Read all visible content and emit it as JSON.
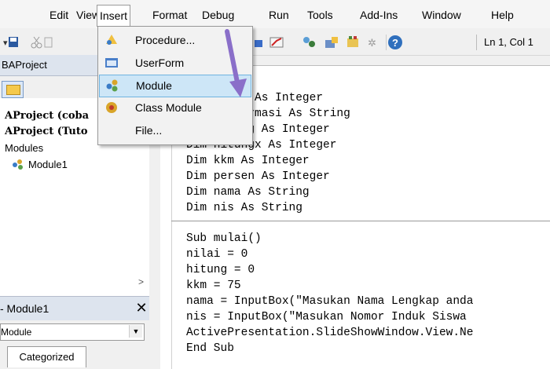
{
  "menubar": {
    "items": [
      "Edit",
      "View",
      "Insert",
      "Format",
      "Debug",
      "Run",
      "Tools",
      "Add-Ins",
      "Window",
      "Help"
    ]
  },
  "toolbar": {
    "position": "Ln 1, Col 1"
  },
  "project": {
    "title": "BAProject",
    "tree": [
      "AProject (coba",
      "AProject (Tuto",
      "Modules",
      "Module1"
    ]
  },
  "properties": {
    "title": "- Module1",
    "close": "✕",
    "object": "Module",
    "tab": "Categorized"
  },
  "insert_menu": {
    "items": [
      {
        "label": "Procedure...",
        "icon": "procedure-icon"
      },
      {
        "label": "UserForm",
        "icon": "userform-icon"
      },
      {
        "label": "Module",
        "icon": "module-icon"
      },
      {
        "label": "Class Module",
        "icon": "class-module-icon"
      },
      {
        "label": "File...",
        "icon": "file-icon"
      }
    ],
    "highlighted": "Module"
  },
  "code": {
    "lines": [
      "Dim nilai As Integer",
      "Dim konfirmasi As String",
      "Dim hitung As Integer",
      "Dim hitungx As Integer",
      "Dim kkm As Integer",
      "Dim persen As Integer",
      "Dim nama As String",
      "Dim nis As String",
      "Sub mulai()",
      "nilai = 0",
      "hitung = 0",
      "kkm = 75",
      "nama = InputBox(\"Masukan Nama Lengkap anda",
      "nis = InputBox(\"Masukan Nomor Induk Siswa",
      "ActivePresentation.SlideShowWindow.View.Ne",
      "End Sub"
    ]
  },
  "colors": {
    "highlight": "#cde6f7",
    "arrow": "#8a6fc9"
  }
}
